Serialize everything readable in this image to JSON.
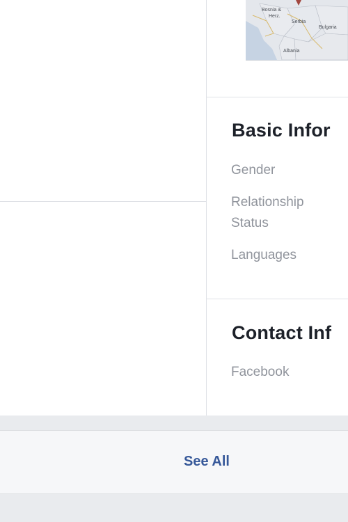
{
  "map": {
    "labels": [
      "Bosnia &",
      "Herz.",
      "Serbia",
      "Bulgaria",
      "Albania"
    ]
  },
  "basic_info": {
    "title": "Basic Infor",
    "fields": [
      "Gender",
      "Relationship",
      "Status",
      "Languages"
    ]
  },
  "contact_info": {
    "title": "Contact Inf",
    "fields": [
      "Facebook"
    ]
  },
  "footer": {
    "see_all_label": "See All"
  }
}
